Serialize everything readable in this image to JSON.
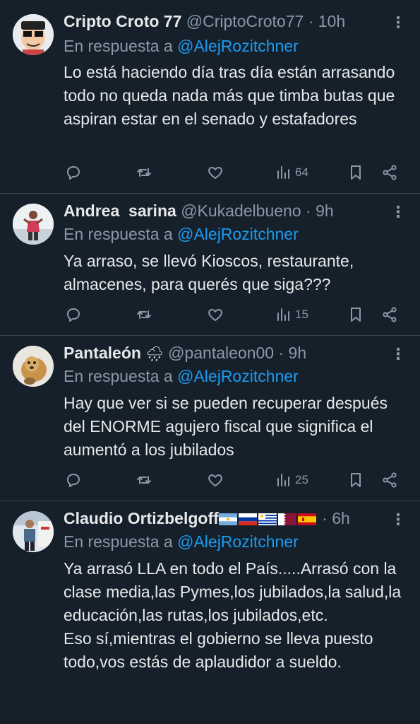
{
  "tweets": [
    {
      "name": "Cripto Croto 77",
      "handle": "@CriptoCroto77",
      "time": "10h",
      "reply_prefix": "En respuesta a",
      "reply_to": "@AlejRozitchner",
      "text": "Lo está haciendo día tras día están arrasando todo no queda nada más que timba butas que aspiran estar en el senado y estafadores",
      "views": "64"
    },
    {
      "name": "Andrea  sarina",
      "handle": "@Kukadelbueno",
      "time": "9h",
      "reply_prefix": "En respuesta a",
      "reply_to": "@AlejRozitchner",
      "text": "Ya arraso, se llevó Kioscos, restaurante, almacenes, para querés que siga???",
      "views": "15"
    },
    {
      "name": "Pantaleón",
      "name_emoji": "🌧",
      "handle": "@pantaleon00",
      "time": "9h",
      "reply_prefix": "En respuesta a",
      "reply_to": "@AlejRozitchner",
      "text": "Hay que ver si se pueden recuperar después del ENORME agujero fiscal que significa el aumentó a los jubilados",
      "views": "25"
    },
    {
      "name": "Claudio Ortizbelgoff",
      "flags": [
        "argentina-flag",
        "russia-flag",
        "uruguay-flag",
        "qatar-flag",
        "spain-flag"
      ],
      "time": "6h",
      "reply_prefix": "En respuesta a",
      "reply_to": "@AlejRozitchner",
      "text": "Ya arrasó LLA en todo el País.....Arrasó con la clase media,las Pymes,los jubilados,la salud,la educación,las rutas,los jubilados,etc.\nEso sí,mientras el gobierno se lleva puesto todo,vos estás de aplaudidor a sueldo."
    }
  ],
  "separator": "·",
  "colors": {
    "background": "#15202b",
    "text": "#e7e9ea",
    "muted": "#8b98a5",
    "mention": "#1d9bf0",
    "divider": "#38444d"
  }
}
